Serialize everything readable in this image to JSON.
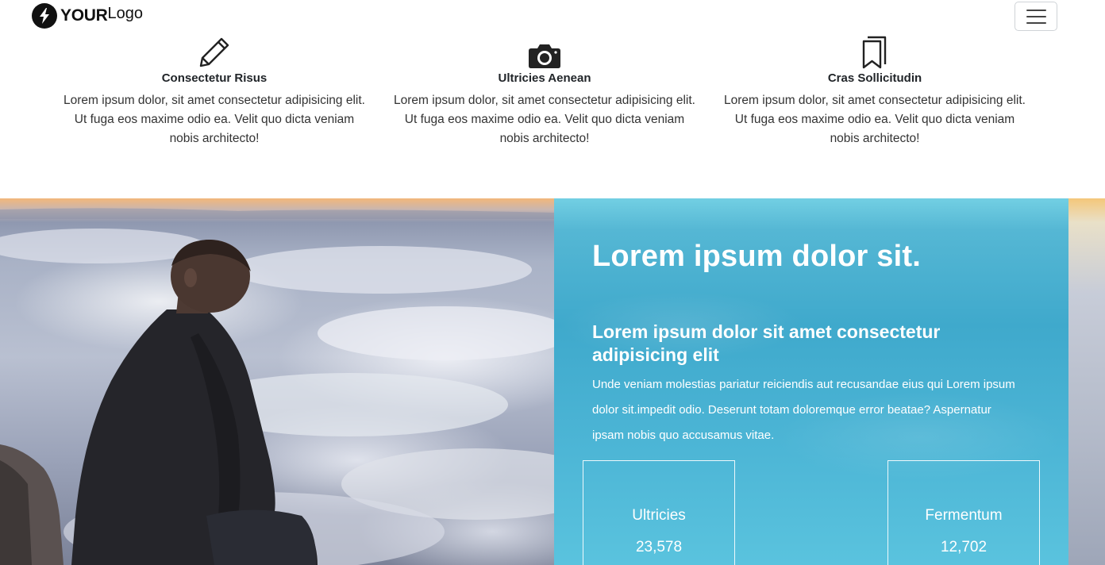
{
  "navbar": {
    "logo_bold": "YOUR",
    "logo_light": "Logo",
    "menu_icon": "hamburger-icon"
  },
  "features": [
    {
      "icon": "pencil-icon",
      "title": "Consectetur Risus",
      "text": "Lorem ipsum dolor, sit amet consectetur adipisicing elit. Ut fuga eos maxime odio ea. Velit quo dicta veniam nobis architecto!"
    },
    {
      "icon": "camera-icon",
      "title": "Ultricies Aenean",
      "text": "Lorem ipsum dolor, sit amet consectetur adipisicing elit. Ut fuga eos maxime odio ea. Velit quo dicta veniam nobis architecto!"
    },
    {
      "icon": "bookmarks-icon",
      "title": "Cras Sollicitudin",
      "text": "Lorem ipsum dolor, sit amet consectetur adipisicing elit. Ut fuga eos maxime odio ea. Velit quo dicta veniam nobis architecto!"
    }
  ],
  "hero": {
    "heading": "Lorem ipsum dolor sit.",
    "subheading": "Lorem ipsum dolor sit amet consectetur adipisicing elit",
    "body": "Unde veniam molestias pariatur reiciendis aut recusandae eius qui Lorem ipsum dolor sit.impedit odio. Deserunt totam doloremque error beatae? Aspernatur ipsam nobis quo accusamus vitae.",
    "overlay_color": "#4db6d6",
    "stats": [
      {
        "label": "Ultricies",
        "value": "23,578"
      },
      {
        "label": "Fermentum",
        "value": "12,702"
      }
    ]
  }
}
